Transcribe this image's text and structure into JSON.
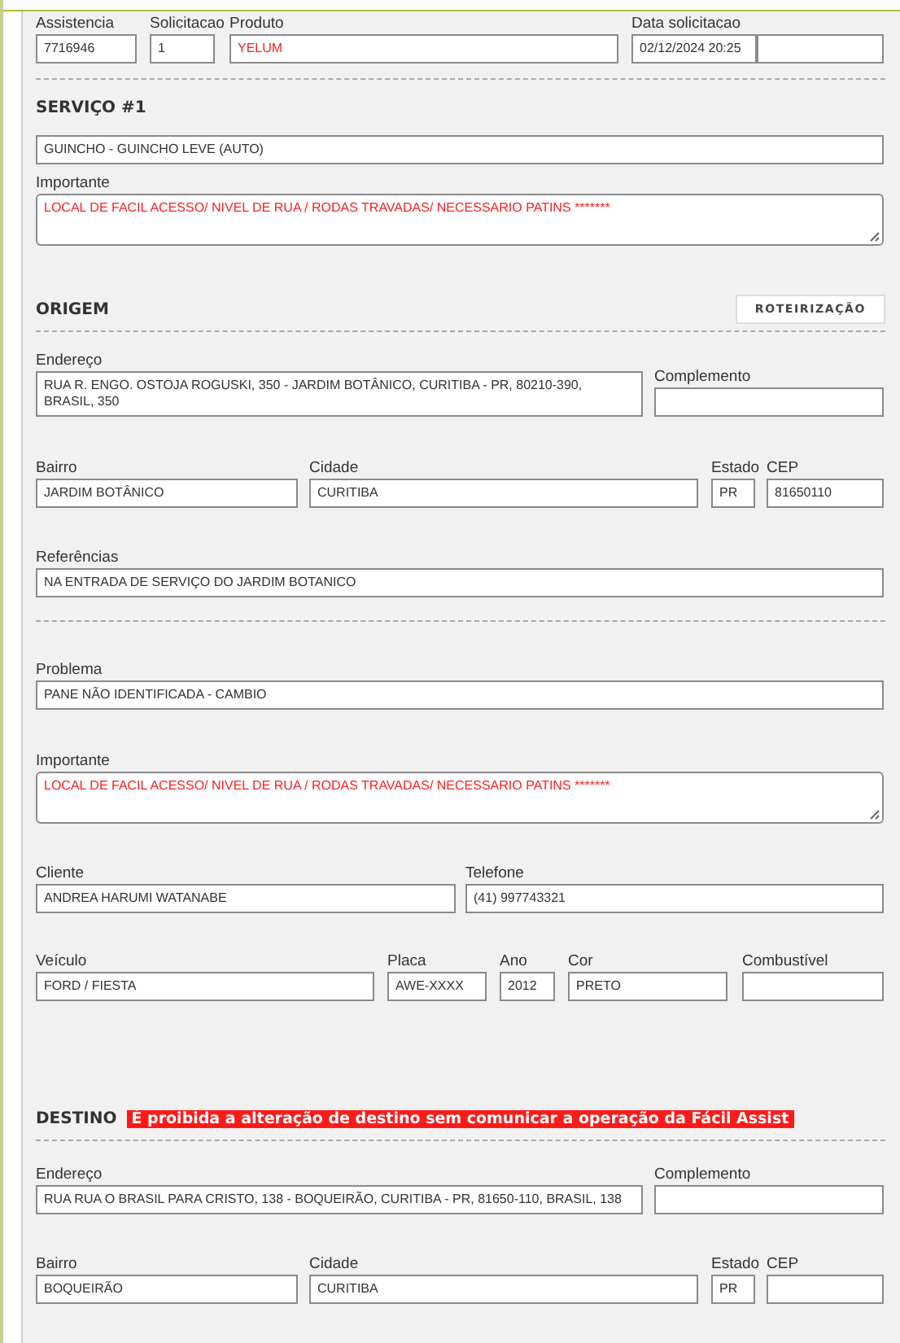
{
  "sections": [
    {
      "kind": "request",
      "rows": [
        {
          "fields": [
            {
              "label": "Assistencia",
              "value": "7716946",
              "kind": "text",
              "alert": false
            },
            {
              "label": "Solicitacao",
              "value": "1",
              "kind": "text",
              "alert": false
            },
            {
              "label": "Produto",
              "value": "YELUM",
              "kind": "text",
              "alert": true
            },
            {
              "label": "Data solicitacao",
              "value": "02/12/2024 20:25",
              "kind": "text",
              "alert": false
            },
            {
              "kind": "text"
            }
          ]
        }
      ]
    },
    {
      "kind": "service",
      "title": "SERVIÇO #1",
      "rows": [
        {
          "fields": [
            {
              "value": "GUINCHO - GUINCHO LEVE (AUTO)",
              "kind": "text",
              "alert": false
            }
          ]
        },
        {
          "fields": [
            {
              "label": "Importante",
              "value": "LOCAL DE FACIL ACESSO/ NIVEL DE RUA / RODAS TRAVADAS/ NECESSARIO PATINS *******",
              "kind": "textarea",
              "alert": true
            }
          ]
        }
      ]
    },
    {
      "kind": "origin",
      "title": "ORIGEM",
      "button": "ROTEIRIZAÇÃO",
      "rows": [
        {
          "fields": [
            {
              "label": "Endereço",
              "value": "RUA R. ENGO. OSTOJA ROGUSKI, 350 - JARDIM BOTÂNICO, CURITIBA - PR, 80210-390, BRASIL, 350",
              "kind": "text",
              "alert": false
            },
            {
              "label": "Complemento",
              "kind": "text"
            }
          ]
        },
        {
          "fields": [
            {
              "label": "Bairro",
              "value": "JARDIM BOTÂNICO",
              "kind": "text",
              "alert": false
            },
            {
              "label": "Cidade",
              "value": "CURITIBA",
              "kind": "text",
              "alert": false
            },
            {
              "label": "Estado",
              "value": "PR",
              "kind": "text",
              "alert": false
            },
            {
              "label": "CEP",
              "value": "81650110",
              "kind": "text",
              "alert": false
            }
          ]
        },
        {
          "fields": [
            {
              "label": "Referências",
              "value": "NA ENTRADA DE SERVIÇO DO JARDIM BOTANICO",
              "kind": "text",
              "alert": false
            }
          ]
        }
      ]
    },
    {
      "kind": "details",
      "rows": [
        {
          "fields": [
            {
              "label": "Problema",
              "value": "PANE NÃO IDENTIFICADA - CAMBIO",
              "kind": "text",
              "alert": false
            }
          ]
        },
        {
          "fields": [
            {
              "label": "Importante",
              "value": "LOCAL DE FACIL ACESSO/ NIVEL DE RUA / RODAS TRAVADAS/ NECESSARIO PATINS *******",
              "kind": "textarea",
              "alert": true
            }
          ]
        },
        {
          "fields": [
            {
              "label": "Cliente",
              "value": "ANDREA HARUMI WATANABE",
              "kind": "text",
              "alert": false
            },
            {
              "label": "Telefone",
              "value": "(41) 997743321",
              "kind": "text",
              "alert": false
            }
          ]
        },
        {
          "fields": [
            {
              "label": "Veículo",
              "value": "FORD / FIESTA",
              "kind": "text",
              "alert": false
            },
            {
              "label": "Placa",
              "value": "AWE-XXXX",
              "kind": "text",
              "alert": false
            },
            {
              "label": "Ano",
              "value": "2012",
              "kind": "text",
              "alert": false
            },
            {
              "label": "Cor",
              "value": "PRETO",
              "kind": "text",
              "alert": false
            },
            {
              "label": "Combustível",
              "kind": "text"
            }
          ]
        }
      ]
    },
    {
      "kind": "destination",
      "title": "DESTINO",
      "warning": "É proibida a alteração de destino sem comunicar a operação da Fácil Assist",
      "rows": [
        {
          "fields": [
            {
              "label": "Endereço",
              "value": "RUA RUA O BRASIL PARA CRISTO, 138 - BOQUEIRÃO, CURITIBA - PR, 81650-110, BRASIL, 138",
              "kind": "text",
              "alert": false
            },
            {
              "label": "Complemento",
              "kind": "text"
            }
          ]
        },
        {
          "fields": [
            {
              "label": "Bairro",
              "value": "BOQUEIRÃO",
              "kind": "text",
              "alert": false
            },
            {
              "label": "Cidade",
              "value": "CURITIBA",
              "kind": "text",
              "alert": false
            },
            {
              "label": "Estado",
              "value": "PR",
              "kind": "text",
              "alert": false
            },
            {
              "label": "CEP",
              "kind": "text"
            }
          ]
        }
      ]
    }
  ]
}
